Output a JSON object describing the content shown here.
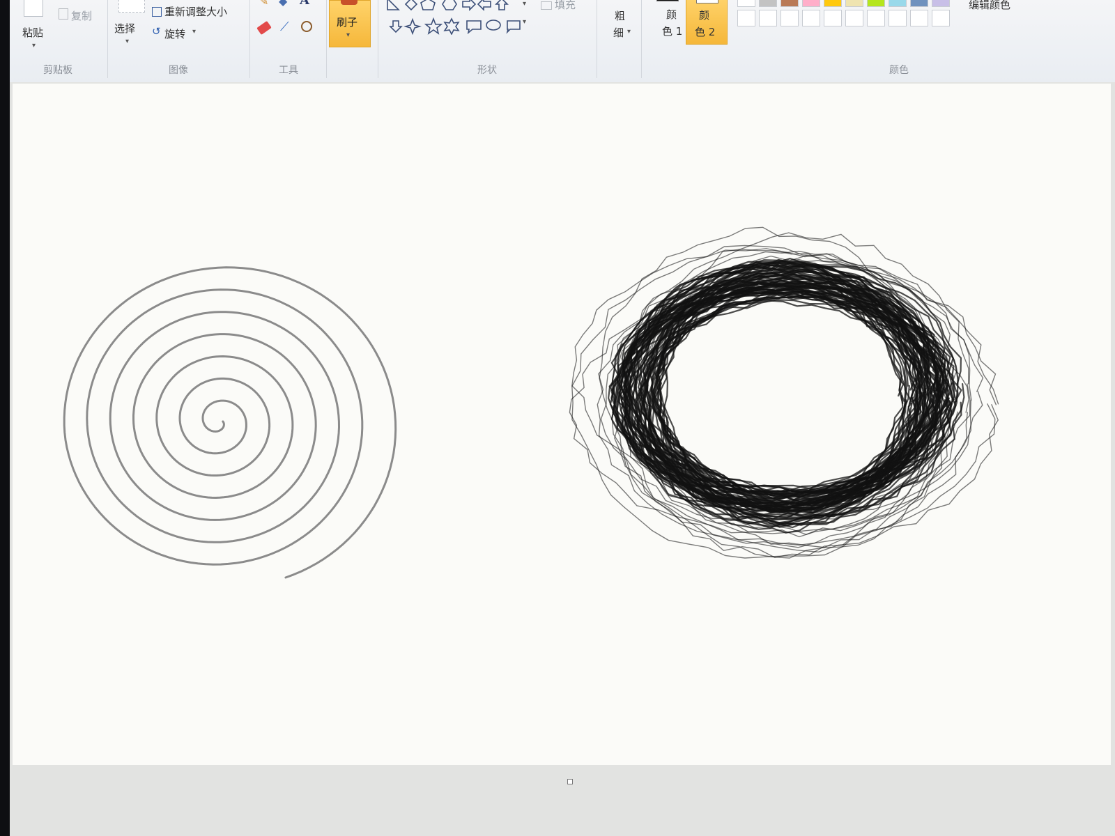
{
  "ribbon": {
    "clipboard": {
      "paste_label": "粘贴",
      "copy_label": "复制",
      "group_label": "剪贴板"
    },
    "image": {
      "select_label": "选择",
      "resize_label": "重新调整大小",
      "rotate_label": "旋转",
      "group_label": "图像"
    },
    "tools": {
      "group_label": "工具"
    },
    "brushes": {
      "label": "刷子"
    },
    "shapes": {
      "fill_label": "填充",
      "group_label": "形状"
    },
    "size": {
      "label_line1": "粗",
      "label_line2": "细"
    },
    "color1": {
      "label_line1": "颜",
      "label_line2": "色 1"
    },
    "color2": {
      "label_line1": "颜",
      "label_line2": "色 2"
    },
    "colors": {
      "group_label": "颜色",
      "edit_label": "编辑颜色",
      "top_row": [
        "#ffffff",
        "#c3c3c3",
        "#b97a57",
        "#ffaec9",
        "#ffc90e",
        "#efe4b0",
        "#b5e61d",
        "#99d9ea",
        "#7092be",
        "#c8bfe7"
      ]
    }
  },
  "canvas": {
    "spiral_color": "#8b8b8b",
    "scribble_color": "#111111"
  }
}
